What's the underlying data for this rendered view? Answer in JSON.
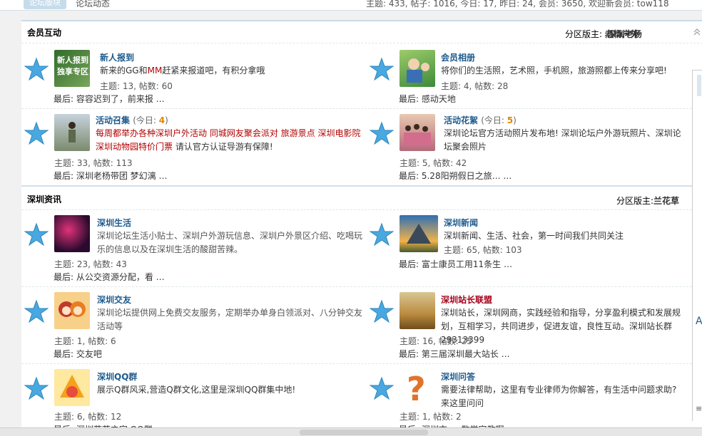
{
  "top": {
    "tab_label": "论坛版块",
    "crumb": "论坛动态",
    "stats": "主题: 433, 帖子: 1016, 今日: 17, 昨日: 24, 会员: 3650, 欢迎新会员: tow118"
  },
  "sections": [
    {
      "title": "会员互动",
      "mods_label": "分区版主:",
      "mods": [
        "老杨户外",
        "深圳老杨"
      ],
      "rows": [
        [
          {
            "name": "新人报到",
            "today_label": "",
            "today_num": "",
            "desc": "新来的GG和",
            "desc_red": "MM",
            "desc_tail": "赶紧来报道吧，有积分拿哦",
            "topics": "主题: 13, 帖数: 60",
            "last": "最后: 容容迟到了，前来报  …"
          },
          {
            "name": "会员相册",
            "today_label": "",
            "today_num": "",
            "desc": "将你们的生活照，艺术照，手机照，旅游照都上传来分享吧!",
            "desc_red": "",
            "desc_tail": "",
            "topics": "主题: 4, 帖数: 28",
            "last": "最后: 感动天地"
          }
        ],
        [
          {
            "name": "活动召集",
            "today_label": "(今日: ",
            "today_num": "4",
            "today_end": ")",
            "promo": "每周都举办各种深圳户外活动  同城网友聚会派对  旅游景点  深圳电影院  深圳动物园特价门票",
            "desc": "请认官方认证导游有保障!",
            "topics": "主题: 33, 帖数: 113",
            "last": "最后: 深圳老杨带团  梦幻漓  …"
          },
          {
            "name": "活动花絮",
            "today_label": "(今日: ",
            "today_num": "5",
            "today_end": ")",
            "desc": "深圳论坛官方活动照片发布地! 深圳论坛户外游玩照片、深圳论坛聚会照片",
            "topics": "主题: 5, 帖数: 42",
            "last": "最后: 5.28阳朔假日之旅…  …"
          }
        ]
      ]
    },
    {
      "title": "深圳资讯",
      "mods_label": "分区版主:",
      "mods": [
        "兰花草"
      ],
      "rows": [
        [
          {
            "name": "深圳生活",
            "desc": "深圳论坛生活小贴士、深圳户外游玩信息、深圳户外景区介绍、吃喝玩乐的信息以及在深圳生活的酸甜苦辣。",
            "topics": "主题: 23, 帖数: 43",
            "last": "最后: 从公交资源分配，看  …"
          },
          {
            "name": "深圳新闻",
            "desc": "深圳新闻、生活、社会，第一时间我们共同关注",
            "topics": "主题: 65, 帖数: 103",
            "last": "最后: 富士康员工用11条生  …"
          }
        ],
        [
          {
            "name": "深圳交友",
            "desc": "深圳论坛提供网上免费交友服务，定期举办单身白领派对、八分钟交友活动等",
            "topics": "主题: 1, 帖数: 6",
            "last": "最后: 交友吧"
          },
          {
            "name": "深圳站长联盟",
            "desc": "深圳站长，深圳网商，实践经验和指导，分享盈利模式和发展规划，互相学习，共同进步，促进友谊，良性互动。深圳站长群29313399",
            "topics": "主题: 16, 帖数: 25",
            "last": "最后: 第三届深圳最大站长  …"
          }
        ],
        [
          {
            "name": "深圳QQ群",
            "desc": "展示Q群风采,营造Q群文化,这里是深圳QQ群集中地!",
            "topics": "主题: 6, 帖数: 12",
            "last": "最后: 深圳花花之家  QQ群"
          },
          {
            "name": "深圳问答",
            "desc": "需要法律帮助，这里有专业律师为你解答，有生活中问题求助? 来这里问问",
            "topics": "主题: 1, 帖数: 2",
            "last": "最后: 深圳市  …  数学家教啊"
          }
        ]
      ]
    }
  ],
  "icons": {
    "star_color": "#4aa8e0",
    "accent": "#1d5a8c",
    "alert": "#b30000"
  }
}
